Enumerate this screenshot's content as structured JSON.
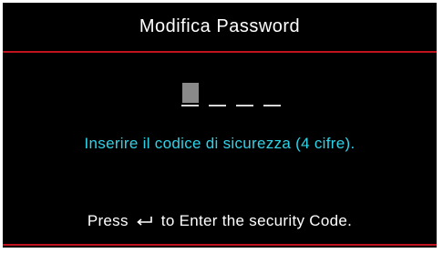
{
  "dialog": {
    "title": "Modifica Password",
    "code": {
      "digits_total": 4,
      "active_index": 0
    },
    "instruction": "Inserire il codice di sicurezza (4 cifre).",
    "hint": {
      "prefix": "Press",
      "icon": "enter-return-icon",
      "suffix": "to Enter the security Code."
    },
    "colors": {
      "background": "#000000",
      "title_text": "#ffffff",
      "accent_rule": "#c1121f",
      "instruction_text": "#2fd3e8",
      "hint_text": "#ffffff"
    }
  }
}
